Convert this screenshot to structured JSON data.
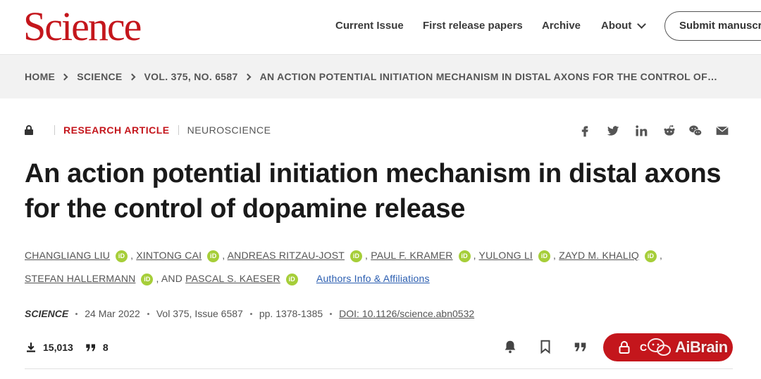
{
  "header": {
    "logo": "Science",
    "nav": {
      "current_issue": "Current Issue",
      "first_release": "First release papers",
      "archive": "Archive",
      "about": "About"
    },
    "submit": "Submit manuscr"
  },
  "breadcrumb": [
    "HOME",
    "SCIENCE",
    "VOL. 375, NO. 6587",
    "AN ACTION POTENTIAL INITIATION MECHANISM IN DISTAL AXONS FOR THE CONTROL OF…"
  ],
  "article": {
    "type": "RESEARCH ARTICLE",
    "section": "NEUROSCIENCE",
    "title": "An action potential initiation mechanism in distal axons for the control of dopamine release",
    "authors": [
      "CHANGLIANG LIU",
      "XINTONG CAI",
      "ANDREAS RITZAU-JOST",
      "PAUL F. KRAMER",
      "YULONG LI",
      "ZAYD M. KHALIQ",
      "STEFAN HALLERMANN",
      "PASCAL S. KAESER"
    ],
    "and_text": ", AND",
    "orcid_label": "iD",
    "affiliations_link": "Authors Info & Affiliations",
    "citation": {
      "journal": "SCIENCE",
      "date": "24 Mar 2022",
      "volume": "Vol 375, Issue 6587",
      "pages": "pp. 1378-1385",
      "doi": "DOI: 10.1126/science.abn0532"
    },
    "metrics": {
      "downloads": "15,013",
      "citations": "8"
    },
    "access_button": "C",
    "watermark": "AiBrain"
  },
  "icons": {
    "share": [
      "facebook-icon",
      "twitter-icon",
      "linkedin-icon",
      "reddit-icon",
      "wechat-icon",
      "email-icon"
    ],
    "actions": [
      "bell-icon",
      "bookmark-icon",
      "quote-icon"
    ]
  },
  "colors": {
    "brand": "#c4161c",
    "link": "#2a5db0",
    "orcid": "#a6ce39",
    "breadcrumb_bg": "#f2f2f2"
  }
}
